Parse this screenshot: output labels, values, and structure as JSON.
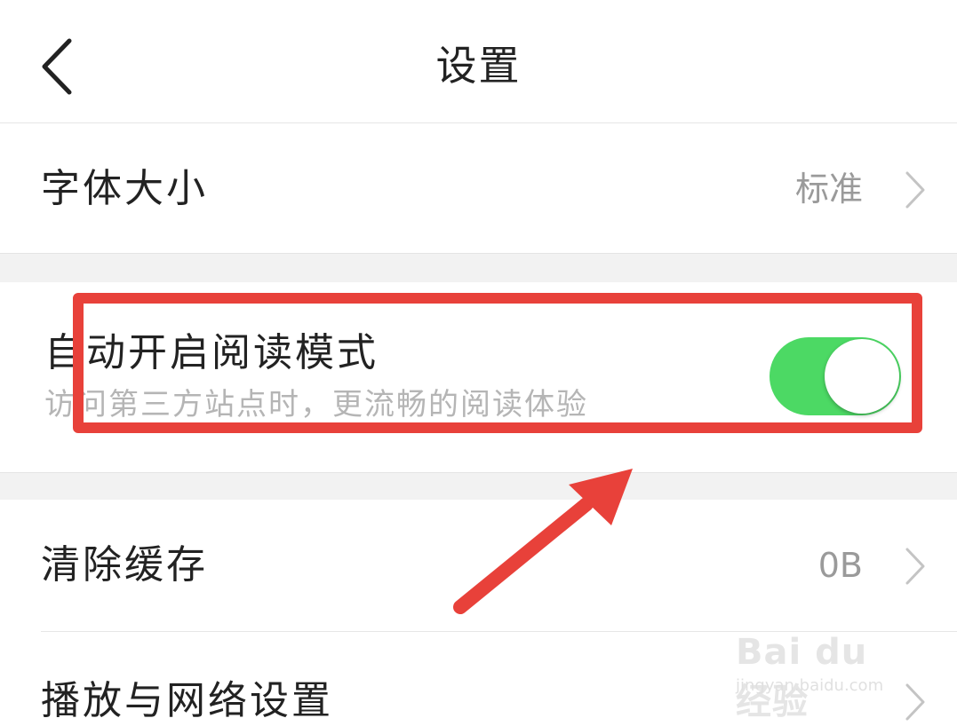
{
  "header": {
    "title": "设置",
    "back_icon": "chevron-left-icon"
  },
  "settings": {
    "font_size": {
      "label": "字体大小",
      "value": "标准"
    },
    "reading_mode": {
      "label": "自动开启阅读模式",
      "description": "访问第三方站点时，更流畅的阅读体验",
      "enabled": true
    },
    "clear_cache": {
      "label": "清除缓存",
      "value": "0B"
    },
    "network": {
      "label": "播放与网络设置"
    }
  },
  "annotation": {
    "highlight_color": "#e8413a",
    "toggle_on_color": "#4cd964"
  },
  "watermark": {
    "brand": "Bai du 经验",
    "url": "jingyan.baidu.com"
  }
}
